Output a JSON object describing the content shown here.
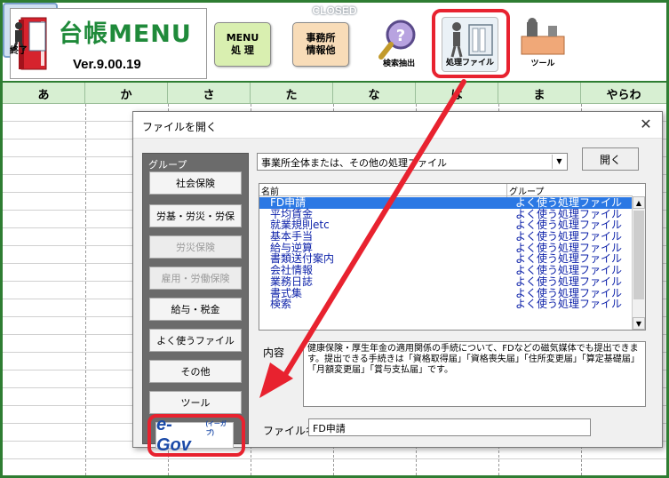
{
  "app": {
    "title": "台帳MENU",
    "version": "Ver.9.00.19"
  },
  "toolbar": {
    "menu_line1": "MENU",
    "menu_line2": "処 理",
    "office_line1": "事務所",
    "office_line2": "情報他",
    "search_label": "検索抽出",
    "process_label": "処理ファイル",
    "tools_label": "ツール",
    "closed_top": "CLOSED",
    "closed_label": "終了"
  },
  "sheet": {
    "kana_headers": [
      "あ",
      "か",
      "さ",
      "た",
      "な",
      "は",
      "ま",
      "やらわ"
    ]
  },
  "dialog": {
    "title": "ファイルを開く",
    "close_glyph": "✕",
    "group_label": "グループ",
    "group_buttons": [
      {
        "label": "社会保険",
        "enabled": true
      },
      {
        "label": "労基・労災・労保",
        "enabled": true
      },
      {
        "label": "労災保険",
        "enabled": false
      },
      {
        "label": "雇用・労働保険",
        "enabled": false
      },
      {
        "label": "給与・税金",
        "enabled": true
      },
      {
        "label": "よく使うファイル",
        "enabled": true
      },
      {
        "label": "その他",
        "enabled": true
      },
      {
        "label": "ツール",
        "enabled": true
      }
    ],
    "egov_text": "e-Gov",
    "egov_sup": "(イーガブ)",
    "category_select": "事業所全体または、その他の処理ファイル",
    "open_button": "開く",
    "list_header_name": "名前",
    "list_header_group": "グループ",
    "files": [
      {
        "name": "FD申請",
        "group": "よく使う処理ファイル",
        "selected": true
      },
      {
        "name": "平均賃金",
        "group": "よく使う処理ファイル"
      },
      {
        "name": "就業規則etc",
        "group": "よく使う処理ファイル"
      },
      {
        "name": "基本手当",
        "group": "よく使う処理ファイル"
      },
      {
        "name": "給与逆算",
        "group": "よく使う処理ファイル"
      },
      {
        "name": "書類送付案内",
        "group": "よく使う処理ファイル"
      },
      {
        "name": "会社情報",
        "group": "よく使う処理ファイル"
      },
      {
        "name": "業務日誌",
        "group": "よく使う処理ファイル"
      },
      {
        "name": "書式集",
        "group": "よく使う処理ファイル"
      },
      {
        "name": "検索",
        "group": "よく使う処理ファイル"
      }
    ],
    "content_label": "内容",
    "content_text": "健康保険・厚生年金の適用関係の手続について、FDなどの磁気媒体でも提出できます。提出できる手続きは「資格取得届」「資格喪失届」「住所変更届」「算定基礎届」「月額変更届」「賞与支払届」です。",
    "filename_label": "ファイル名",
    "filename_value": "FD申請"
  },
  "colors": {
    "accent_green": "#2e7d32",
    "highlight_red": "#e8222f",
    "selection_blue": "#2b78e4"
  }
}
